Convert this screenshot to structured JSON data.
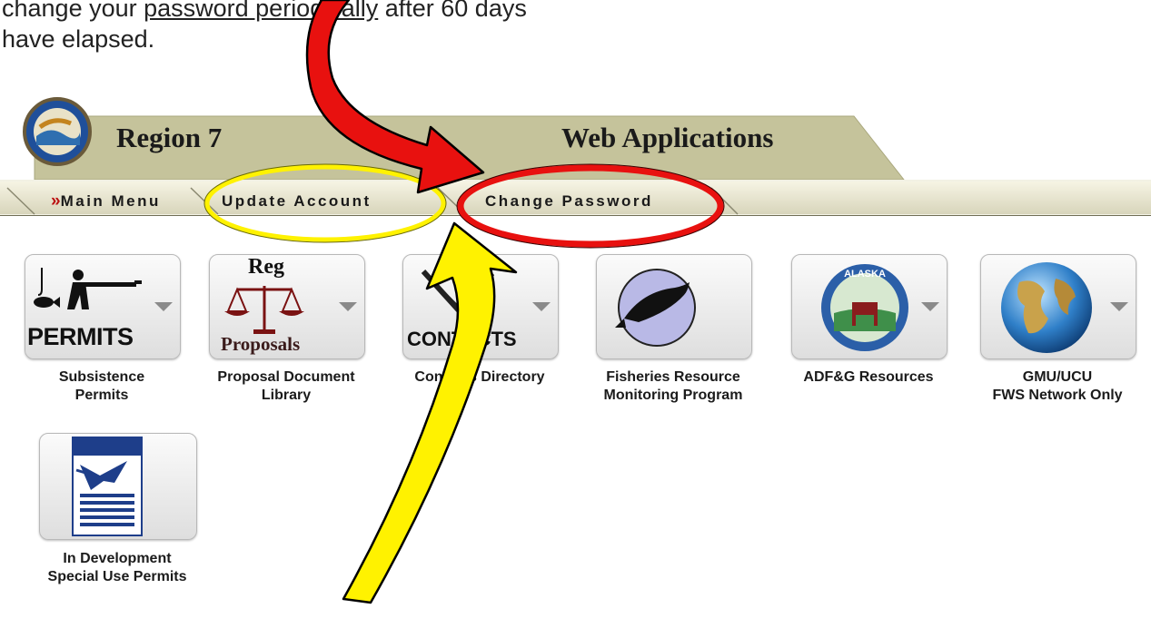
{
  "intro": {
    "line1_prefix": "change your ",
    "line1_link": "password periodically",
    "line1_suffix": " after 60 days",
    "line2": "have elapsed."
  },
  "banner": {
    "region": "Region 7",
    "title": "Web Applications"
  },
  "nav": {
    "main_menu": "Main Menu",
    "update_account": "Update Account",
    "change_password": "Change Password"
  },
  "apps": [
    {
      "icon": "permits-icon",
      "tile_word": "PERMITS",
      "lines": [
        "Subsistence",
        "Permits"
      ]
    },
    {
      "icon": "reg-proposals-icon",
      "tile_word_top": "Reg",
      "tile_word": "Proposals",
      "lines": [
        "Proposal Document",
        "Library"
      ]
    },
    {
      "icon": "contacts-icon",
      "tile_word": "CONTACTS",
      "lines": [
        "Contacts Directory"
      ]
    },
    {
      "icon": "fish-icon",
      "lines": [
        "Fisheries Resource",
        "Monitoring Program"
      ]
    },
    {
      "icon": "adfg-seal-icon",
      "seal_text": "ALASKA",
      "lines": [
        "ADF&G Resources"
      ]
    },
    {
      "icon": "globe-icon",
      "lines": [
        "GMU/UCU",
        "FWS Network Only"
      ]
    },
    {
      "icon": "nwrs-icon",
      "lines": [
        "In Development",
        "Special Use Permits"
      ]
    }
  ],
  "colors": {
    "banner": "#c5c39b",
    "red_annotation": "#e8110f",
    "yellow_annotation": "#fff200"
  }
}
